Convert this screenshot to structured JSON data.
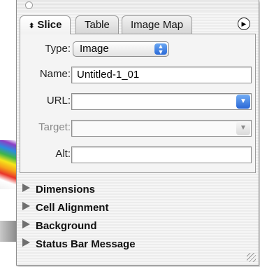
{
  "tabs": [
    {
      "label": "Slice",
      "active": true
    },
    {
      "label": "Table",
      "active": false
    },
    {
      "label": "Image Map",
      "active": false
    }
  ],
  "form": {
    "type_label": "Type:",
    "type_value": "Image",
    "name_label": "Name:",
    "name_value": "Untitled-1_01",
    "url_label": "URL:",
    "url_value": "",
    "target_label": "Target:",
    "target_value": "",
    "alt_label": "Alt:",
    "alt_value": ""
  },
  "sections": [
    {
      "label": "Dimensions"
    },
    {
      "label": "Cell Alignment"
    },
    {
      "label": "Background"
    },
    {
      "label": "Status Bar Message"
    }
  ],
  "icons": {
    "close": "close-circle-icon",
    "tab_sort": "up-down-arrows-icon",
    "options": "options-arrow-icon",
    "disclosure": "disclosure-triangle-icon",
    "resize": "resize-grip-icon"
  },
  "colors": {
    "accent_blue": "#2b6ad8",
    "panel_bg": "#f4f4f4"
  }
}
